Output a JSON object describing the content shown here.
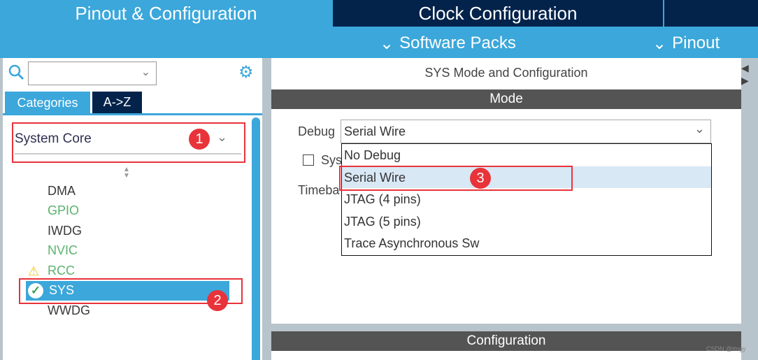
{
  "tabs": [
    "Pinout & Configuration",
    "Clock Configuration"
  ],
  "subnav": {
    "software_packs": "Software Packs",
    "pinout": "Pinout"
  },
  "sidebar": {
    "search_value": "",
    "view_tabs": [
      "Categories",
      "A->Z"
    ],
    "category": "System Core",
    "items": [
      {
        "label": "DMA",
        "status": "none"
      },
      {
        "label": "GPIO",
        "status": "configured"
      },
      {
        "label": "IWDG",
        "status": "none"
      },
      {
        "label": "NVIC",
        "status": "configured"
      },
      {
        "label": "RCC",
        "status": "warning"
      },
      {
        "label": "SYS",
        "status": "ok",
        "selected": true
      },
      {
        "label": "WWDG",
        "status": "none"
      }
    ]
  },
  "main": {
    "title": "SYS Mode and Configuration",
    "mode_header": "Mode",
    "debug_label": "Debug",
    "debug_value": "Serial Wire",
    "checkbox_label_partial": "Sys",
    "timebase_label_partial": "Timeba",
    "debug_options": [
      "No Debug",
      "Serial Wire",
      "JTAG (4 pins)",
      "JTAG (5 pins)",
      "Trace Asynchronous Sw"
    ],
    "config_header": "Configuration"
  },
  "annotations": [
    "1",
    "2",
    "3"
  ],
  "watermark": "CSDN @#ngy",
  "colors": {
    "accent": "#3ba7db",
    "navy": "#03234b",
    "annotation": "#e8333a",
    "header": "#535453"
  }
}
